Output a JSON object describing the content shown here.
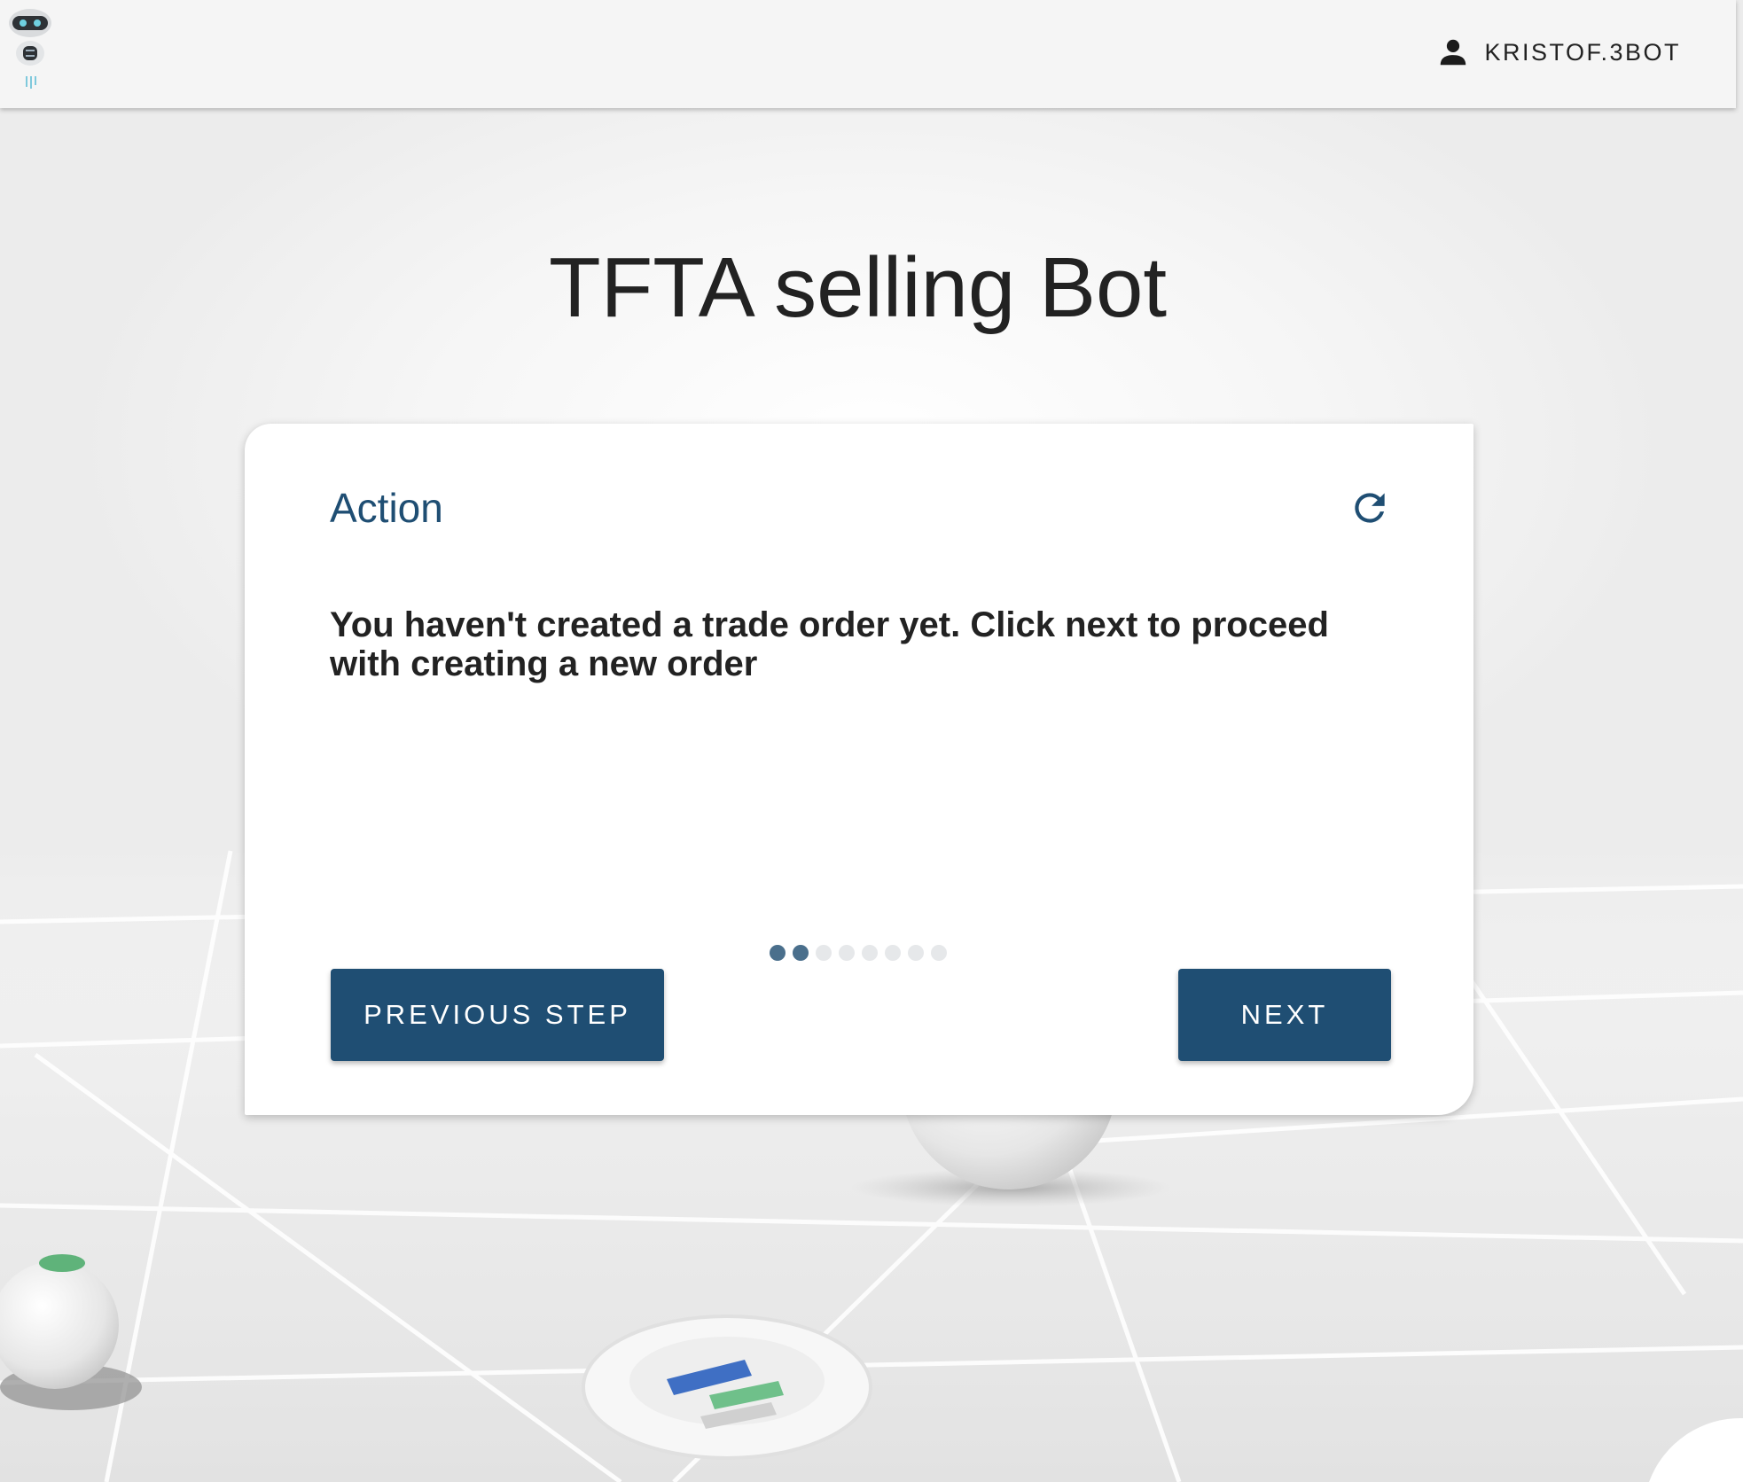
{
  "header": {
    "logo_icon": "robot-logo-icon",
    "user": {
      "icon": "person-icon",
      "name": "KRISTOF.3BOT"
    }
  },
  "page": {
    "title": "TFTA selling Bot"
  },
  "card": {
    "title": "Action",
    "refresh_icon": "refresh-icon",
    "message": "You haven't created a trade order yet. Click next to proceed with creating a new order",
    "stepper": {
      "total_steps": 8,
      "completed_steps": 2
    },
    "buttons": {
      "previous_label": "PREVIOUS STEP",
      "next_label": "NEXT"
    }
  },
  "colors": {
    "primary": "#1f4e73",
    "step_active": "#4a6f8c",
    "step_inactive": "#e6e8ea",
    "topbar_bg": "#f5f5f5",
    "text": "#222222"
  }
}
